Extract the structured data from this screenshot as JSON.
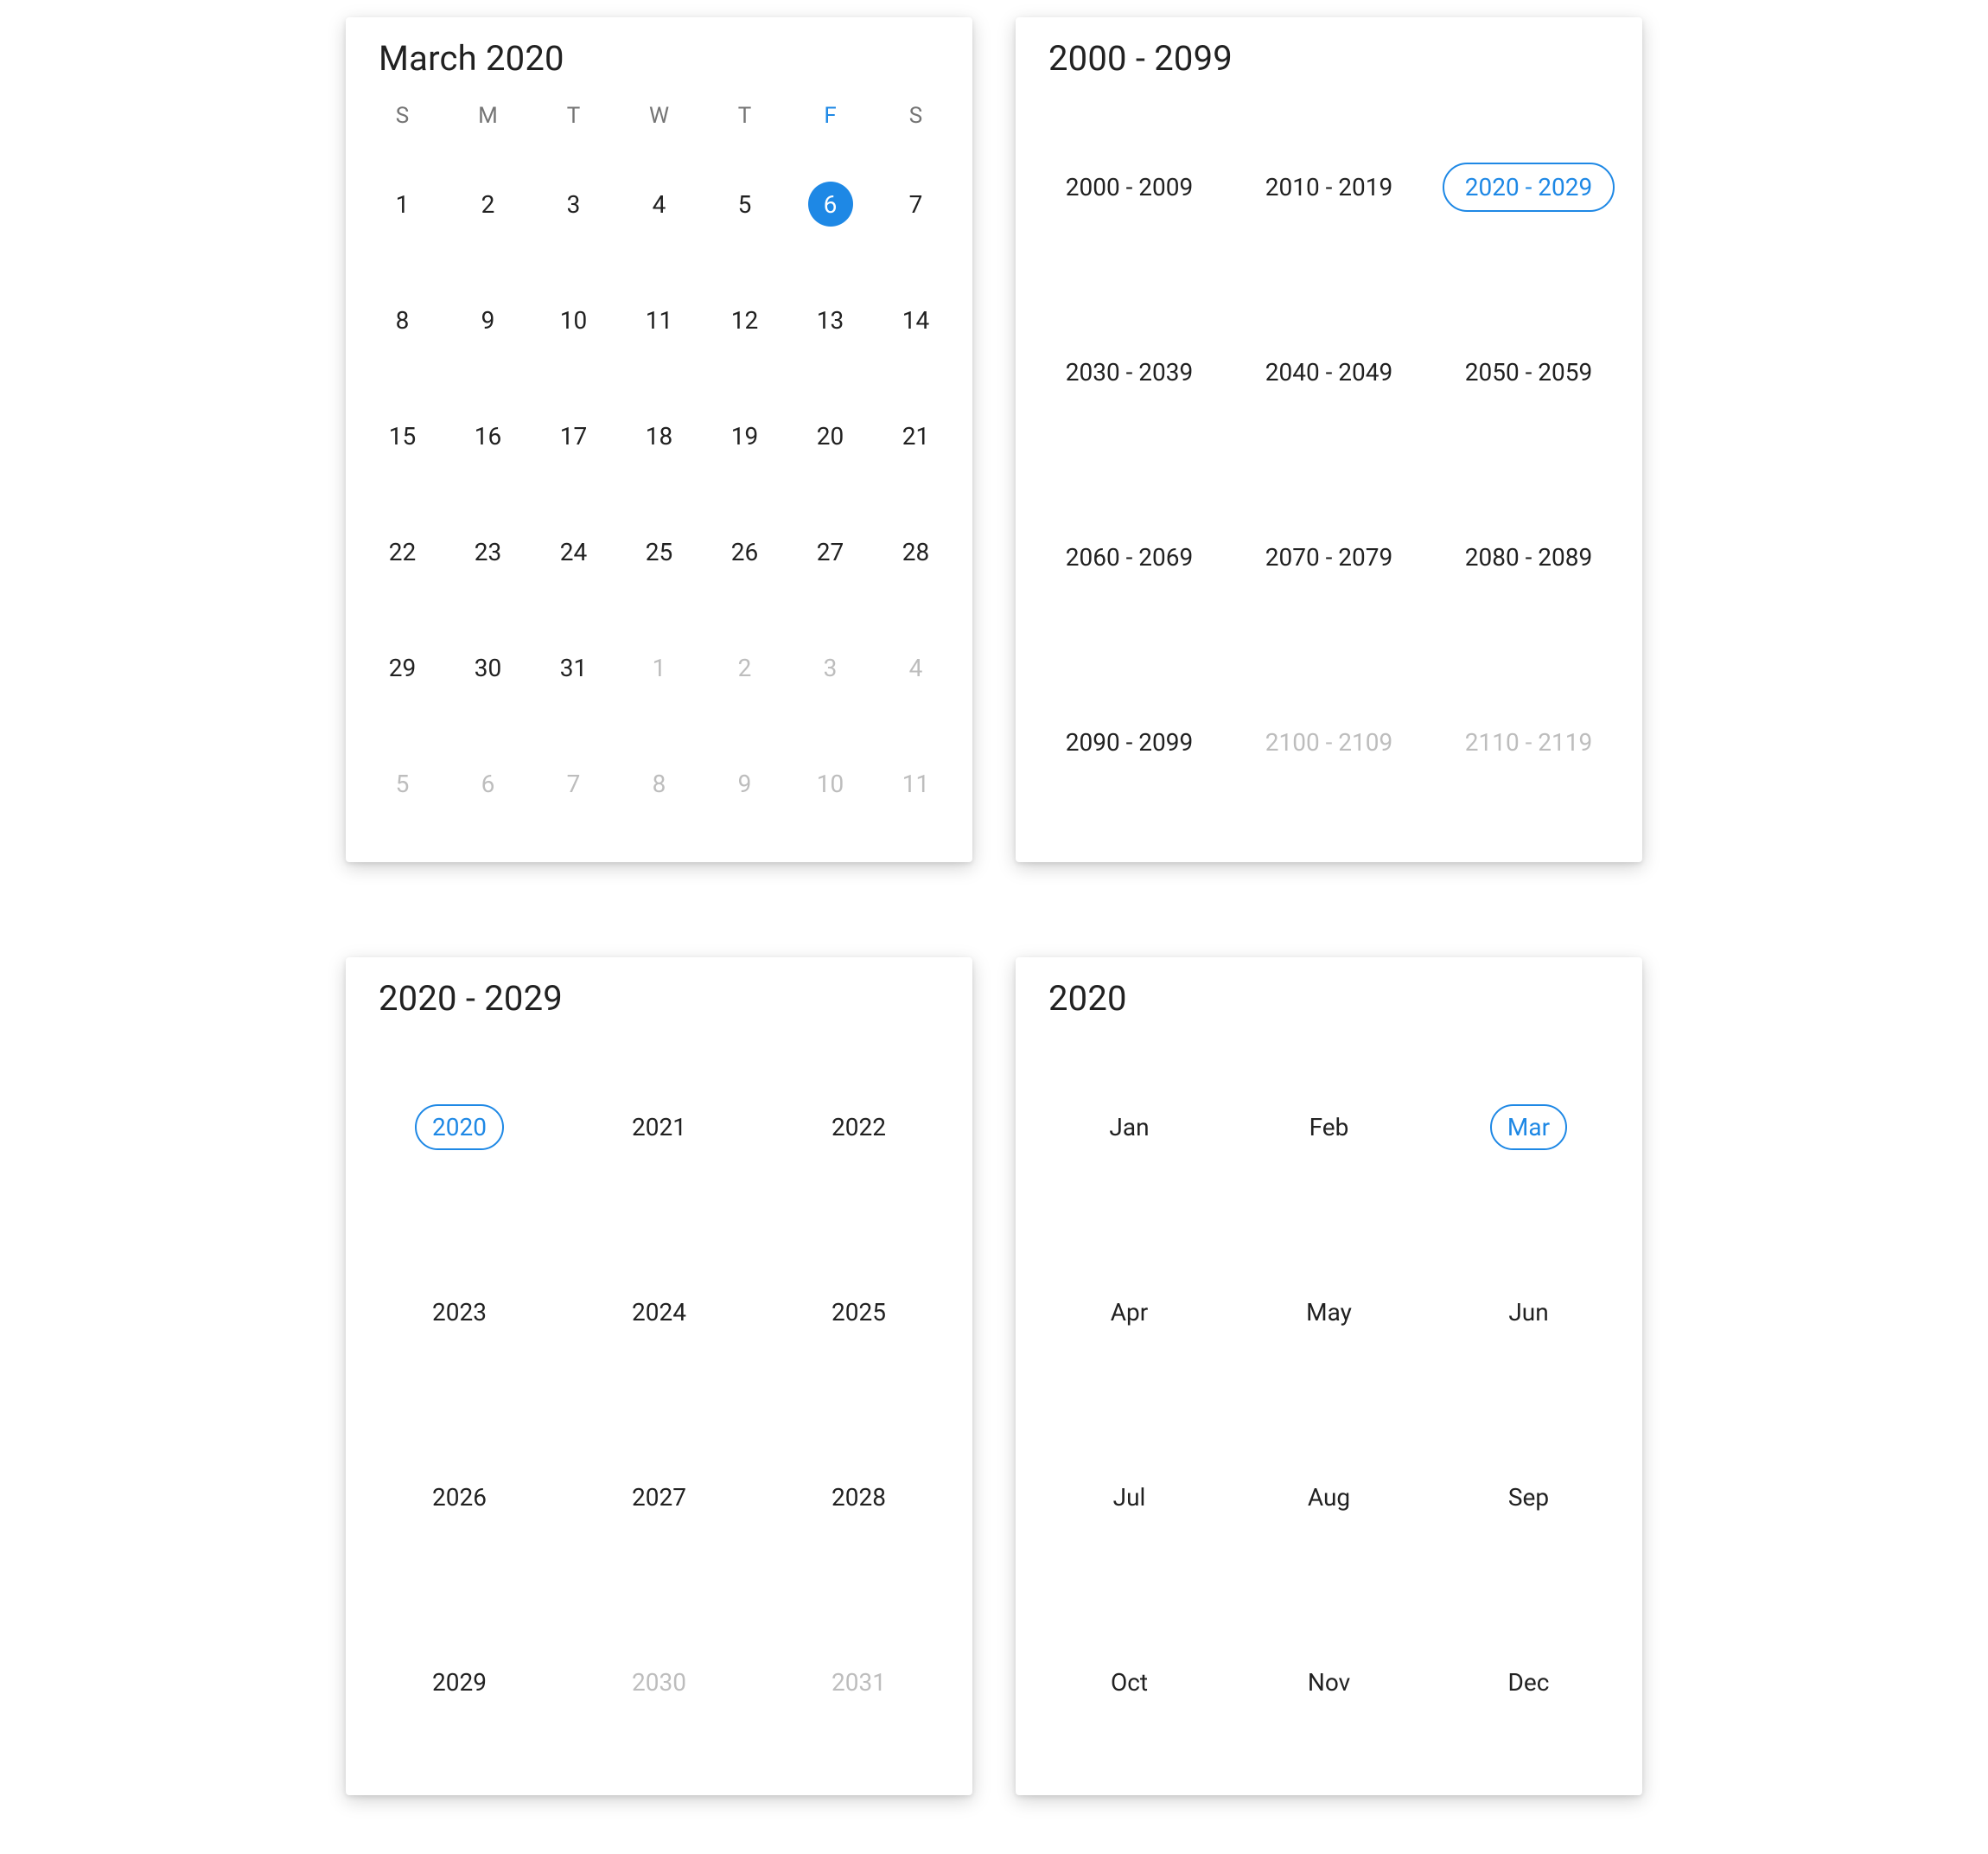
{
  "accent": "#1e88e5",
  "day_picker": {
    "title": "March 2020",
    "dow": [
      "S",
      "M",
      "T",
      "W",
      "T",
      "F",
      "S"
    ],
    "active_dow_index": 5,
    "weeks": [
      [
        {
          "n": 1,
          "outside": false,
          "selected": false
        },
        {
          "n": 2,
          "outside": false,
          "selected": false
        },
        {
          "n": 3,
          "outside": false,
          "selected": false
        },
        {
          "n": 4,
          "outside": false,
          "selected": false
        },
        {
          "n": 5,
          "outside": false,
          "selected": false
        },
        {
          "n": 6,
          "outside": false,
          "selected": true
        },
        {
          "n": 7,
          "outside": false,
          "selected": false
        }
      ],
      [
        {
          "n": 8
        },
        {
          "n": 9
        },
        {
          "n": 10
        },
        {
          "n": 11
        },
        {
          "n": 12
        },
        {
          "n": 13
        },
        {
          "n": 14
        }
      ],
      [
        {
          "n": 15
        },
        {
          "n": 16
        },
        {
          "n": 17
        },
        {
          "n": 18
        },
        {
          "n": 19
        },
        {
          "n": 20
        },
        {
          "n": 21
        }
      ],
      [
        {
          "n": 22
        },
        {
          "n": 23
        },
        {
          "n": 24
        },
        {
          "n": 25
        },
        {
          "n": 26
        },
        {
          "n": 27
        },
        {
          "n": 28
        }
      ],
      [
        {
          "n": 29
        },
        {
          "n": 30
        },
        {
          "n": 31
        },
        {
          "n": 1,
          "outside": true
        },
        {
          "n": 2,
          "outside": true
        },
        {
          "n": 3,
          "outside": true
        },
        {
          "n": 4,
          "outside": true
        }
      ],
      [
        {
          "n": 5,
          "outside": true
        },
        {
          "n": 6,
          "outside": true
        },
        {
          "n": 7,
          "outside": true
        },
        {
          "n": 8,
          "outside": true
        },
        {
          "n": 9,
          "outside": true
        },
        {
          "n": 10,
          "outside": true
        },
        {
          "n": 11,
          "outside": true
        }
      ]
    ]
  },
  "century_picker": {
    "title": "2000 - 2099",
    "items": [
      {
        "label": "2000 - 2009"
      },
      {
        "label": "2010 - 2019"
      },
      {
        "label": "2020 - 2029",
        "selected": true
      },
      {
        "label": "2030 - 2039"
      },
      {
        "label": "2040 - 2049"
      },
      {
        "label": "2050 - 2059"
      },
      {
        "label": "2060 - 2069"
      },
      {
        "label": "2070 - 2079"
      },
      {
        "label": "2080 - 2089"
      },
      {
        "label": "2090 - 2099"
      },
      {
        "label": "2100 - 2109",
        "outside": true
      },
      {
        "label": "2110 - 2119",
        "outside": true
      }
    ]
  },
  "decade_picker": {
    "title": "2020 - 2029",
    "items": [
      {
        "label": "2020",
        "selected": true
      },
      {
        "label": "2021"
      },
      {
        "label": "2022"
      },
      {
        "label": "2023"
      },
      {
        "label": "2024"
      },
      {
        "label": "2025"
      },
      {
        "label": "2026"
      },
      {
        "label": "2027"
      },
      {
        "label": "2028"
      },
      {
        "label": "2029"
      },
      {
        "label": "2030",
        "outside": true
      },
      {
        "label": "2031",
        "outside": true
      }
    ]
  },
  "month_picker": {
    "title": "2020",
    "items": [
      {
        "label": "Jan"
      },
      {
        "label": "Feb"
      },
      {
        "label": "Mar",
        "selected": true
      },
      {
        "label": "Apr"
      },
      {
        "label": "May"
      },
      {
        "label": "Jun"
      },
      {
        "label": "Jul"
      },
      {
        "label": "Aug"
      },
      {
        "label": "Sep"
      },
      {
        "label": "Oct"
      },
      {
        "label": "Nov"
      },
      {
        "label": "Dec"
      }
    ]
  }
}
